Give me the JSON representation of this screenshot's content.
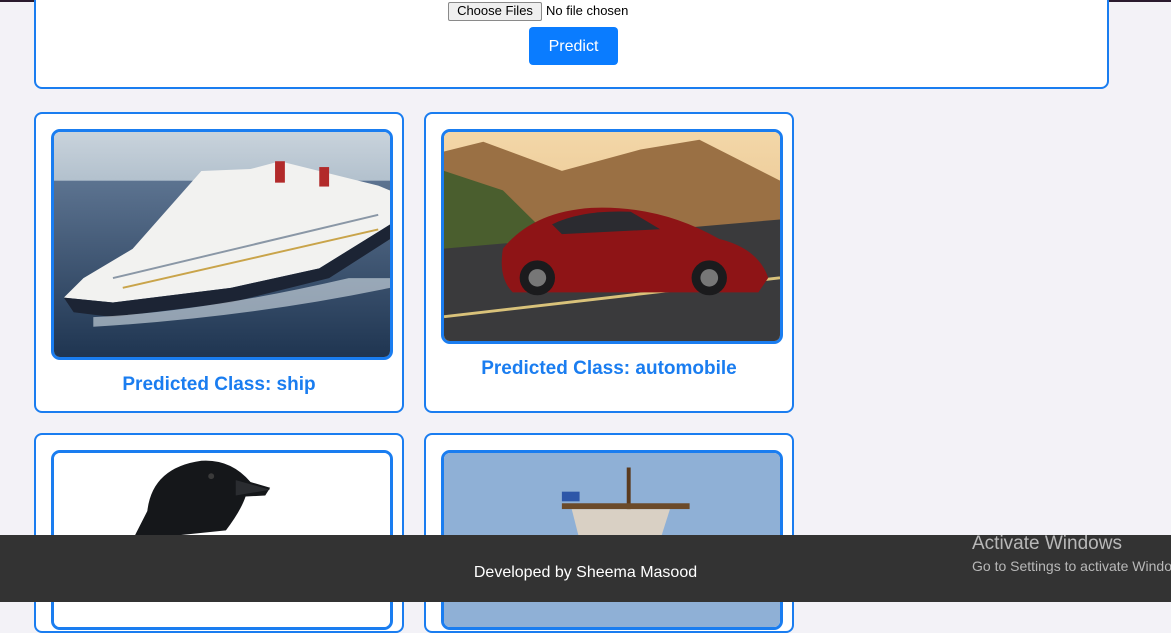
{
  "upload": {
    "choose_files_label": "Choose Files",
    "file_status": "No file chosen",
    "predict_label": "Predict"
  },
  "results": [
    {
      "image": "cruise-ship-photo",
      "caption": "Predicted Class: ship"
    },
    {
      "image": "red-sports-car-photo",
      "caption": "Predicted Class: automobile"
    },
    {
      "image": "black-bird-photo",
      "caption": ""
    },
    {
      "image": "sailing-ship-photo",
      "caption": ""
    }
  ],
  "footer": {
    "text": "Developed by Sheema Masood"
  },
  "os_overlay": {
    "title": "Activate Windows",
    "subtitle": "Go to Settings to activate Windows."
  },
  "colors": {
    "accent": "#1a7df0",
    "button": "#0a7cff",
    "footer_bg": "#333333",
    "page_bg": "#f3f2f7"
  }
}
